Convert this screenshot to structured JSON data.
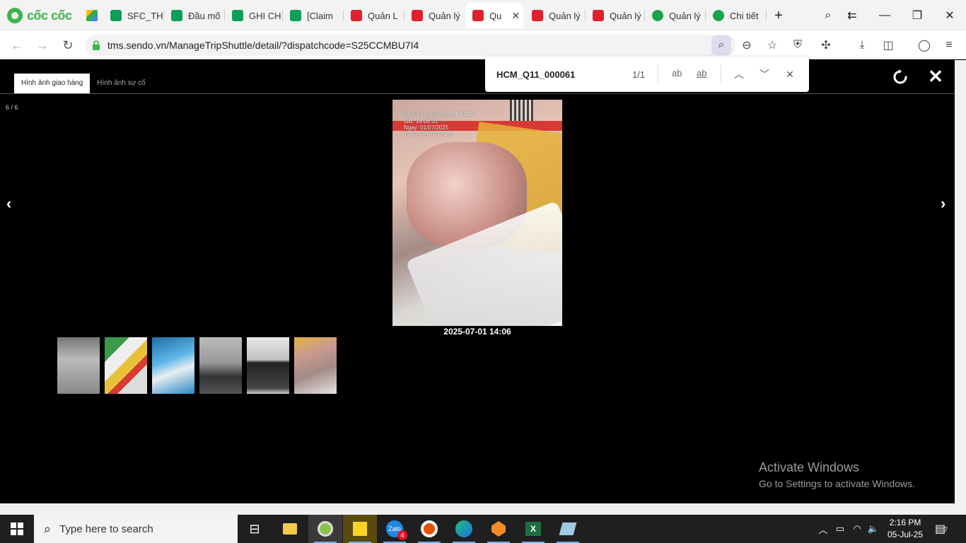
{
  "browser": {
    "brand": "cốc cốc",
    "tabs": [
      {
        "label": "SFC_TH",
        "favicon": "sheets-icon"
      },
      {
        "label": "Đầu mố",
        "favicon": "sheets-icon"
      },
      {
        "label": "GHI CH",
        "favicon": "sheets-icon"
      },
      {
        "label": "[Claim",
        "favicon": "sheets-icon"
      },
      {
        "label": "Quản L",
        "favicon": "sendo-icon"
      },
      {
        "label": "Quản lý",
        "favicon": "sendo-icon"
      },
      {
        "label": "Qu",
        "favicon": "sendo-icon",
        "active": true
      },
      {
        "label": "Quản lý",
        "favicon": "sendo-icon"
      },
      {
        "label": "Quản lý",
        "favicon": "sendo-icon"
      },
      {
        "label": "Quản lý",
        "favicon": "chi-icon"
      },
      {
        "label": "Chi tiết",
        "favicon": "chi-icon"
      }
    ],
    "url": "tms.sendo.vn/ManageTripShuttle/detail/?dispatchcode=S25CCMBU7I4"
  },
  "find": {
    "query": "HCM_Q11_000061",
    "count": "1/1",
    "match_case": "ab",
    "whole_word": "ab"
  },
  "viewer": {
    "tabs": [
      "Hình ảnh giao hàng",
      "Hình ảnh sự cố"
    ],
    "counter": "6 / 6",
    "prev": "‹",
    "next": "›",
    "close": "✕",
    "photo_overlay": [
      "Chuyen: chuyen_3_IP43422",
      "Gio: 14:06:31",
      "Ngay: 01/07/2025",
      "Tai xe: 0976079455"
    ],
    "photo_date": "2025-07-01 14:06"
  },
  "watermark": {
    "line1": "Activate Windows",
    "line2": "Go to Settings to activate Windows."
  },
  "taskbar": {
    "search_placeholder": "Type here to search",
    "time": "2:16 PM",
    "date": "05-Jul-25",
    "notif_count": "7",
    "zalo_badge": "4"
  }
}
